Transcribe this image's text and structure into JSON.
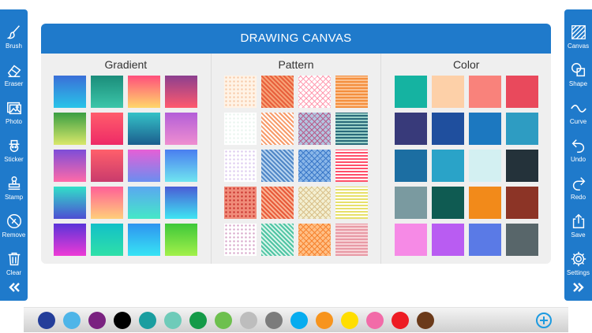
{
  "left_toolbar": {
    "items": [
      {
        "label": "Brush",
        "icon": "brush-icon"
      },
      {
        "label": "Eraser",
        "icon": "eraser-icon"
      },
      {
        "label": "Photo",
        "icon": "photo-icon"
      },
      {
        "label": "Sticker",
        "icon": "sticker-icon"
      },
      {
        "label": "Stamp",
        "icon": "stamp-icon"
      },
      {
        "label": "Remove",
        "icon": "remove-icon"
      },
      {
        "label": "Clear",
        "icon": "trash-icon"
      }
    ],
    "collapse_icon": "double-chevron-left-icon"
  },
  "right_toolbar": {
    "items": [
      {
        "label": "Canvas",
        "icon": "canvas-icon"
      },
      {
        "label": "Shape",
        "icon": "shape-icon"
      },
      {
        "label": "Curve",
        "icon": "curve-icon"
      },
      {
        "label": "Undo",
        "icon": "undo-icon"
      },
      {
        "label": "Redo",
        "icon": "redo-icon"
      },
      {
        "label": "Save",
        "icon": "save-icon"
      },
      {
        "label": "Settings",
        "icon": "gear-icon"
      }
    ],
    "expand_icon": "double-chevron-right-icon"
  },
  "panel": {
    "title": "DRAWING CANVAS",
    "sections": {
      "gradient": {
        "title": "Gradient"
      },
      "pattern": {
        "title": "Pattern"
      },
      "color": {
        "title": "Color"
      }
    }
  },
  "gradients": [
    [
      "#3a6fd8",
      "#29c4e8"
    ],
    [
      "#1b8c7a",
      "#3cc6a9"
    ],
    [
      "#ff4f7c",
      "#ffd76a"
    ],
    [
      "#8c3f8f",
      "#ff5a6e"
    ],
    [
      "#3a9e43",
      "#d9e86a"
    ],
    [
      "#ff5d6c",
      "#ee2a66"
    ],
    [
      "#35c2c7",
      "#1b5d8e"
    ],
    [
      "#b35ed8",
      "#ef8ed0"
    ],
    [
      "#7d4dd8",
      "#ff6aa8"
    ],
    [
      "#ff5f6b",
      "#c93b6c"
    ],
    [
      "#e65fd6",
      "#6a8ef0"
    ],
    [
      "#4a7ef0",
      "#6fe5f0"
    ],
    [
      "#31e0c8",
      "#4d4ed3"
    ],
    [
      "#ff5f97",
      "#ffcf7a"
    ],
    [
      "#5aa7f0",
      "#45e8c8"
    ],
    [
      "#4a5cd6",
      "#3fe5f2"
    ],
    [
      "#5a34d8",
      "#ee3ad6"
    ],
    [
      "#12c0c8",
      "#2fe0a8"
    ],
    [
      "#2f94f0",
      "#37e4f4"
    ],
    [
      "#3ec83a",
      "#a3f04a"
    ]
  ],
  "patterns": [
    [
      "#f6c9a8",
      "#fff3e6"
    ],
    [
      "#e85f3c",
      "#f7a277"
    ],
    [
      "#ff9bb0",
      "#ffffff"
    ],
    [
      "#f48f3e",
      "#fbc190"
    ],
    [
      "#e8f4ee",
      "#ffffff"
    ],
    [
      "#f79b6a",
      "#ffffff"
    ],
    [
      "#b85c8a",
      "#b2c5e0"
    ],
    [
      "#2a6a7a",
      "#9ad0c8"
    ],
    [
      "#dcc9ef",
      "#ffffff"
    ],
    [
      "#4f86c6",
      "#b6d3ef"
    ],
    [
      "#3a78c8",
      "#89b6e8"
    ],
    [
      "#ff4f6a",
      "#ffffff"
    ],
    [
      "#c8322e",
      "#f08c7a"
    ],
    [
      "#e85a3a",
      "#f9b394"
    ],
    [
      "#d9c08a",
      "#f3efd1"
    ],
    [
      "#e7e06a",
      "#ffffff"
    ],
    [
      "#d6a3c8",
      "#ffffff"
    ],
    [
      "#4fc3a3",
      "#d8f5ea"
    ],
    [
      "#f6832f",
      "#ffbf86"
    ],
    [
      "#e89aa6",
      "#f7d2d6"
    ]
  ],
  "colors": [
    "#15b3a1",
    "#fdd0a8",
    "#f9827b",
    "#e9495c",
    "#383a7a",
    "#1f4f9e",
    "#1c78c0",
    "#2e9cc2",
    "#1c6ea2",
    "#2aa3c8",
    "#d3f0f2",
    "#24323a",
    "#7a9aa0",
    "#0f5b52",
    "#f28a1a",
    "#8c3426",
    "#f68ae6",
    "#b95cf2",
    "#5a7ae6",
    "#58666a"
  ],
  "palette": {
    "dots": [
      "#243e9a",
      "#4eb5e8",
      "#7a2280",
      "#000000",
      "#1a9ea0",
      "#6ecbb9",
      "#149a48",
      "#6dc04e",
      "#bdbdbd",
      "#7c7c7c",
      "#07acef",
      "#f7941d",
      "#ffde00",
      "#f26ba8",
      "#ed1c24",
      "#6b3a1a"
    ],
    "add_icon": "plus-circle-icon",
    "add_color": "#1c9ae0"
  }
}
